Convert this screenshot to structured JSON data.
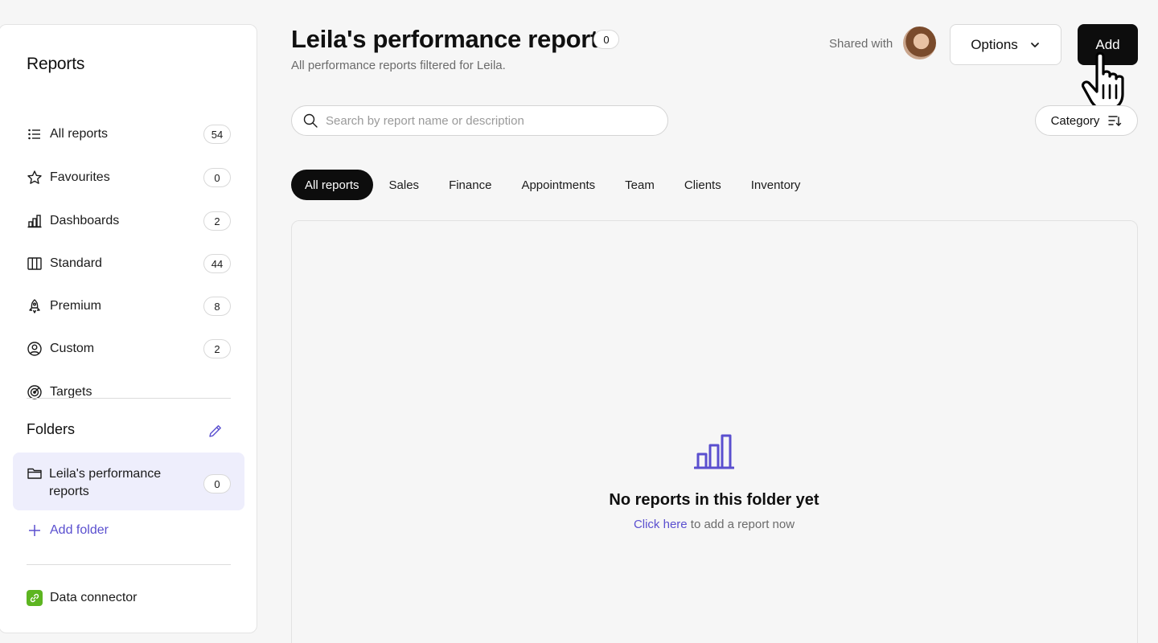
{
  "sidebar": {
    "title": "Reports",
    "items": [
      {
        "label": "All reports",
        "count": "54",
        "icon": "list-icon"
      },
      {
        "label": "Favourites",
        "count": "0",
        "icon": "star-icon"
      },
      {
        "label": "Dashboards",
        "count": "2",
        "icon": "bar-chart-icon"
      },
      {
        "label": "Standard",
        "count": "44",
        "icon": "columns-icon"
      },
      {
        "label": "Premium",
        "count": "8",
        "icon": "rocket-icon"
      },
      {
        "label": "Custom",
        "count": "2",
        "icon": "user-circle-icon"
      },
      {
        "label": "Targets",
        "count": "",
        "icon": "target-icon"
      }
    ],
    "folders_title": "Folders",
    "folders": [
      {
        "label": "Leila's performance reports",
        "count": "0"
      }
    ],
    "add_folder_label": "Add folder",
    "data_connector_label": "Data connector"
  },
  "header": {
    "title": "Leila's performance reports",
    "count": "0",
    "subtitle": "All performance reports filtered for Leila.",
    "shared_with_label": "Shared with",
    "options_label": "Options",
    "add_label": "Add"
  },
  "search": {
    "placeholder": "Search by report name or description",
    "value": ""
  },
  "category_label": "Category",
  "tabs": [
    {
      "label": "All reports",
      "active": true
    },
    {
      "label": "Sales"
    },
    {
      "label": "Finance"
    },
    {
      "label": "Appointments"
    },
    {
      "label": "Team"
    },
    {
      "label": "Clients"
    },
    {
      "label": "Inventory"
    }
  ],
  "empty_state": {
    "title": "No reports in this folder yet",
    "link_text": "Click here",
    "rest_text": " to add a report now"
  },
  "colors": {
    "accent": "#5a4fcf",
    "primary_button": "#0d0d0d",
    "folder_selected_bg": "#eeeefc",
    "data_connector_green": "#5db521"
  }
}
